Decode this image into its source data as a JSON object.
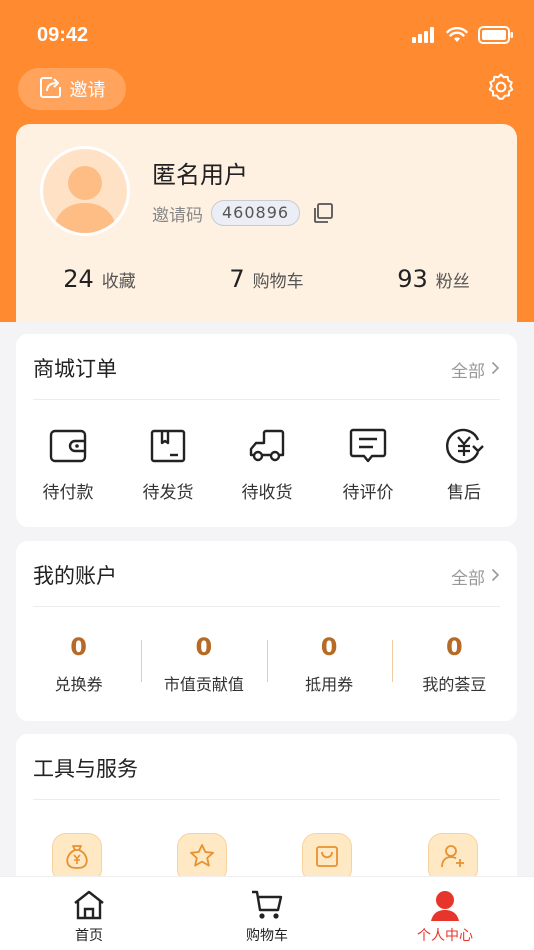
{
  "status_bar": {
    "time": "09:42"
  },
  "header": {
    "invite_label": "邀请"
  },
  "profile": {
    "name": "匿名用户",
    "invite_label": "邀请码",
    "invite_code": "460896",
    "stats": [
      {
        "value": "24",
        "label": "收藏"
      },
      {
        "value": "7",
        "label": "购物车"
      },
      {
        "value": "93",
        "label": "粉丝"
      }
    ]
  },
  "orders": {
    "title": "商城订单",
    "more": "全部",
    "items": [
      {
        "label": "待付款",
        "icon": "wallet-icon"
      },
      {
        "label": "待发货",
        "icon": "package-icon"
      },
      {
        "label": "待收货",
        "icon": "truck-icon"
      },
      {
        "label": "待评价",
        "icon": "comment-icon"
      },
      {
        "label": "售后",
        "icon": "refund-icon"
      }
    ]
  },
  "account": {
    "title": "我的账户",
    "more": "全部",
    "items": [
      {
        "value": "0",
        "label": "兑换券"
      },
      {
        "value": "0",
        "label": "市值贡献值"
      },
      {
        "value": "0",
        "label": "抵用券"
      },
      {
        "value": "0",
        "label": "我的荟豆"
      }
    ]
  },
  "tools": {
    "title": "工具与服务",
    "items": [
      {
        "icon": "money-bag-icon"
      },
      {
        "icon": "star-icon"
      },
      {
        "icon": "shopping-bag-icon"
      },
      {
        "icon": "add-user-icon"
      }
    ]
  },
  "tabbar": {
    "items": [
      {
        "label": "首页",
        "icon": "home-icon"
      },
      {
        "label": "购物车",
        "icon": "cart-icon"
      },
      {
        "label": "个人中心",
        "icon": "person-icon",
        "active": true
      }
    ]
  },
  "colors": {
    "brand_orange": "#ff8a30",
    "profile_bg": "#fff1e1",
    "account_number": "#b66a26",
    "active_tab": "#e8352b"
  }
}
